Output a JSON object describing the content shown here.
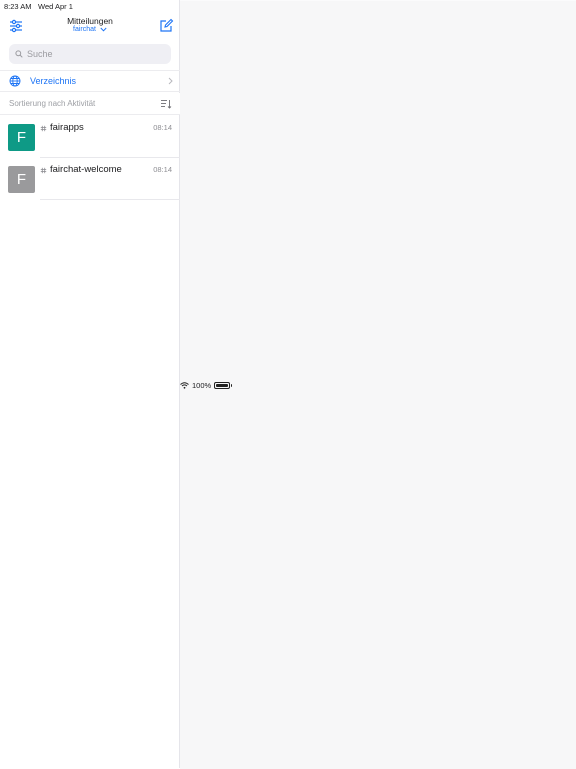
{
  "status_bar": {
    "time": "8:23 AM",
    "date": "Wed Apr 1",
    "battery": "100%",
    "battery_level": 1.0
  },
  "header": {
    "title": "Mitteilungen",
    "subtitle": "fairchat"
  },
  "search": {
    "placeholder": "Suche",
    "value": ""
  },
  "directory": {
    "label": "Verzeichnis"
  },
  "sort": {
    "label": "Sortierung nach Aktivität"
  },
  "rooms": [
    {
      "avatar_letter": "F",
      "avatar_color": "#0e9a86",
      "name": "fairapps",
      "time": "08:14"
    },
    {
      "avatar_letter": "F",
      "avatar_color": "#9a9a9c",
      "name": "fairchat-welcome",
      "time": "08:14"
    }
  ],
  "colors": {
    "accent": "#1d74f5",
    "bubble_primary": "#1d74f5",
    "bubble_secondary": "#d9dadd"
  },
  "icons": [
    "filter-icon",
    "compose-icon",
    "search-icon",
    "globe-icon",
    "chevron-right-icon",
    "sort-icon",
    "hash-icon",
    "wifi-icon",
    "battery-icon",
    "chevron-down-icon"
  ]
}
